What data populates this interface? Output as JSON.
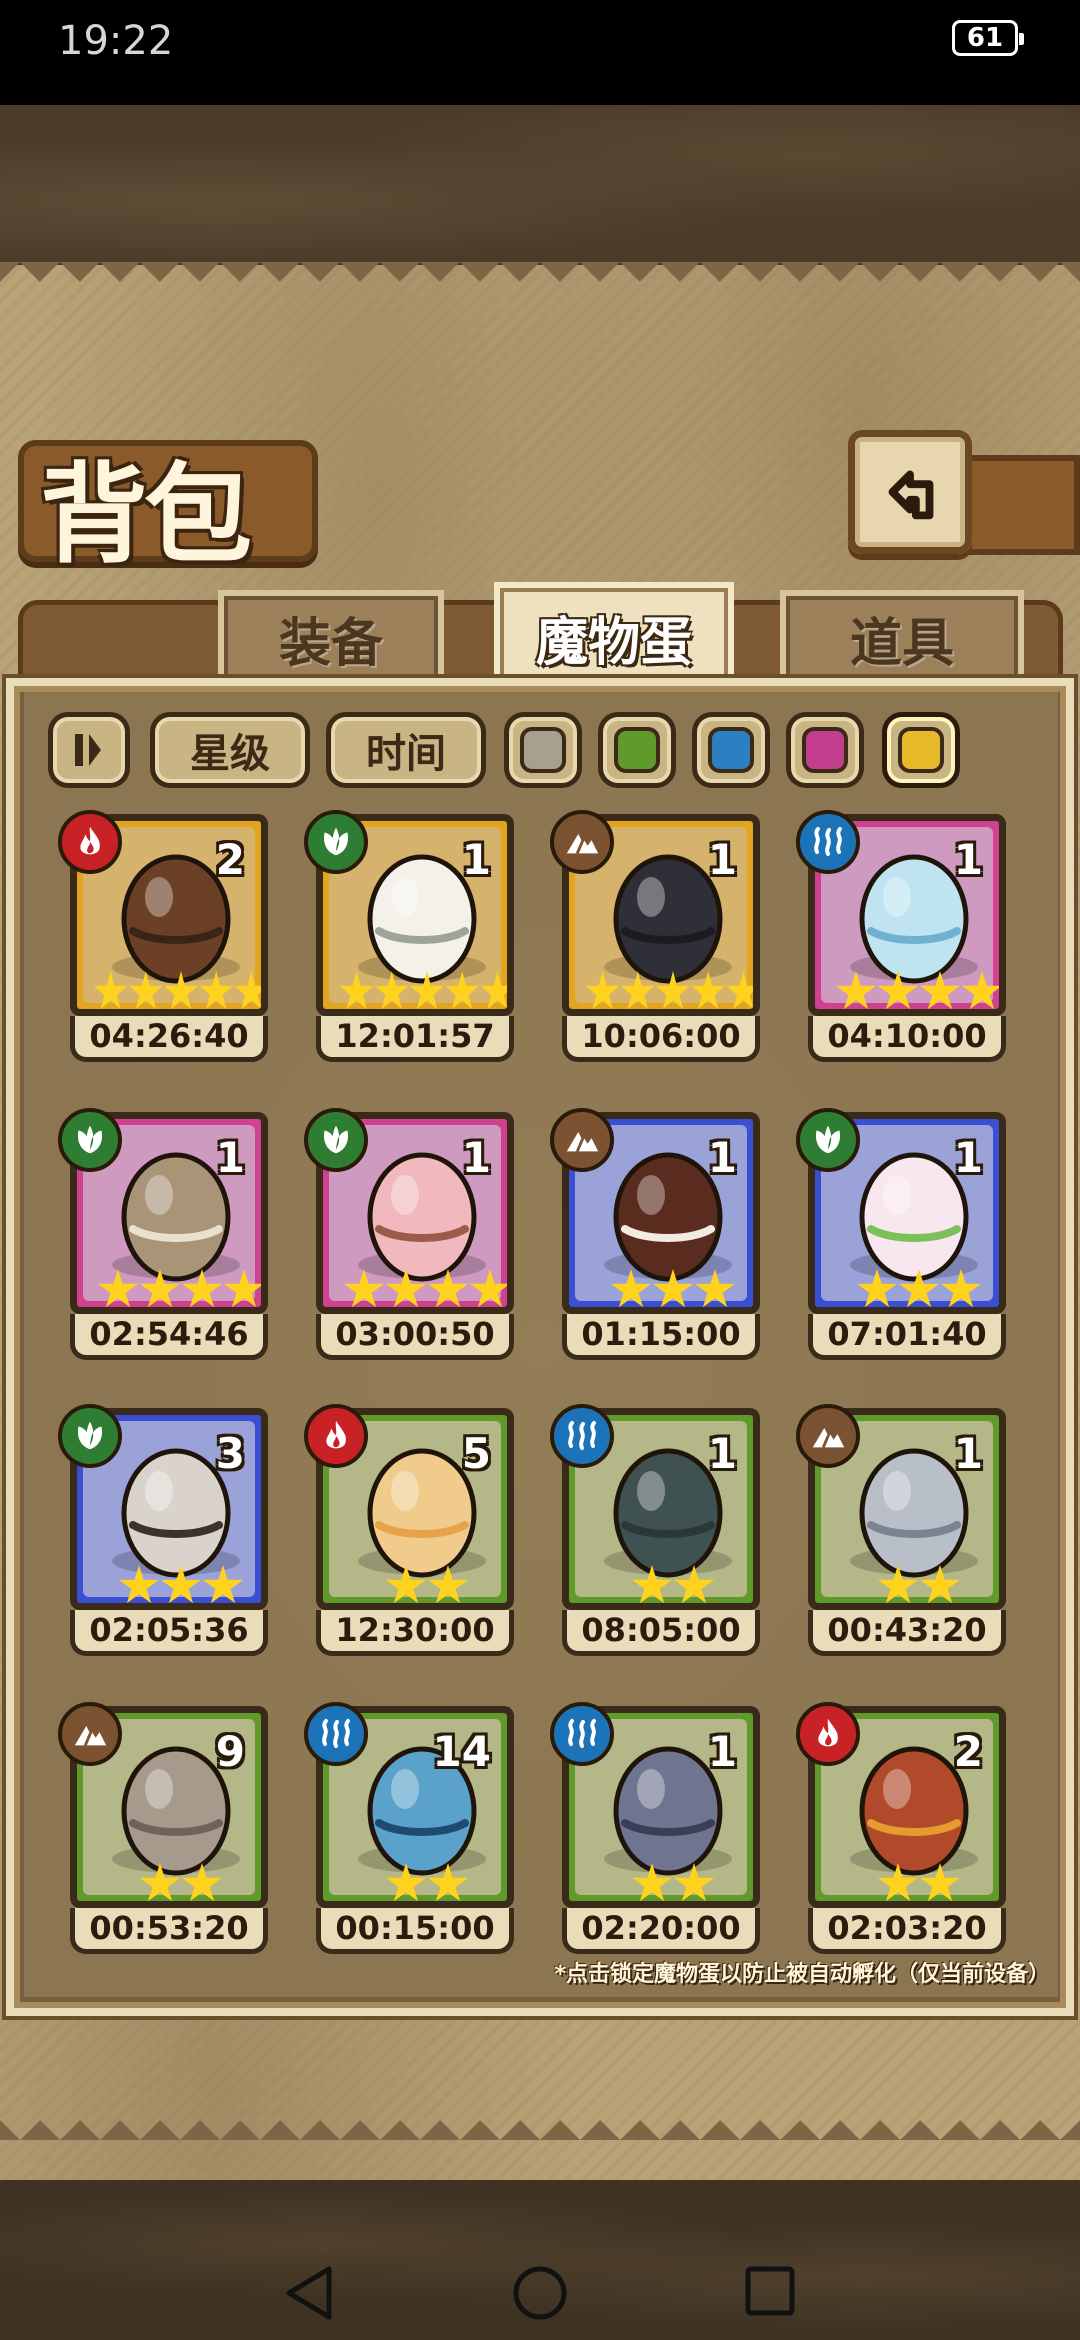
{
  "status_bar": {
    "time": "19:22",
    "battery": "61"
  },
  "header": {
    "title": "背包"
  },
  "tabs": [
    {
      "label": "装备",
      "active": false
    },
    {
      "label": "魔物蛋",
      "active": true
    },
    {
      "label": "道具",
      "active": false
    }
  ],
  "filters": {
    "star_label": "星级",
    "time_label": "时间",
    "swatches": [
      "#a8a08c",
      "#5f9a2a",
      "#2c7fc0",
      "#c33f8e",
      "#e5b92a"
    ]
  },
  "eggs": [
    {
      "element": "fire",
      "rarity": "gold",
      "count": "2",
      "stars": 5,
      "timer": "04:26:40"
    },
    {
      "element": "leaf",
      "rarity": "gold",
      "count": "1",
      "stars": 5,
      "timer": "12:01:57"
    },
    {
      "element": "earth",
      "rarity": "gold",
      "count": "1",
      "stars": 5,
      "timer": "10:06:00"
    },
    {
      "element": "water",
      "rarity": "pink",
      "count": "1",
      "stars": 4,
      "timer": "04:10:00"
    },
    {
      "element": "leaf",
      "rarity": "pink",
      "count": "1",
      "stars": 4,
      "timer": "02:54:46"
    },
    {
      "element": "leaf",
      "rarity": "pink",
      "count": "1",
      "stars": 4,
      "timer": "03:00:50"
    },
    {
      "element": "earth",
      "rarity": "blue",
      "count": "1",
      "stars": 3,
      "timer": "01:15:00"
    },
    {
      "element": "leaf",
      "rarity": "blue",
      "count": "1",
      "stars": 3,
      "timer": "07:01:40"
    },
    {
      "element": "leaf",
      "rarity": "blue",
      "count": "3",
      "stars": 3,
      "timer": "02:05:36"
    },
    {
      "element": "fire",
      "rarity": "green",
      "count": "5",
      "stars": 2,
      "timer": "12:30:00"
    },
    {
      "element": "water",
      "rarity": "green",
      "count": "1",
      "stars": 2,
      "timer": "08:05:00"
    },
    {
      "element": "earth",
      "rarity": "green",
      "count": "1",
      "stars": 2,
      "timer": "00:43:20"
    },
    {
      "element": "earth",
      "rarity": "green",
      "count": "9",
      "stars": 2,
      "timer": "00:53:20"
    },
    {
      "element": "water",
      "rarity": "green",
      "count": "14",
      "stars": 2,
      "timer": "00:15:00"
    },
    {
      "element": "water",
      "rarity": "green",
      "count": "1",
      "stars": 2,
      "timer": "02:20:00"
    },
    {
      "element": "fire",
      "rarity": "green",
      "count": "2",
      "stars": 2,
      "timer": "02:03:20"
    }
  ],
  "footnote": "*点击锁定魔物蛋以防止被自动孵化（仅当前设备）",
  "colors": {
    "parchment": "#b8a276",
    "panel": "#8c7651",
    "fire": "#c82227",
    "leaf": "#2e7d32",
    "water": "#1c73b8",
    "earth": "#7b5232"
  }
}
